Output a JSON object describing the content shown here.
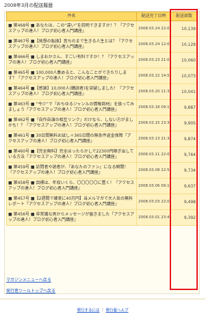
{
  "page_title": "2008年3月の配送履歴",
  "table": {
    "headers": {
      "title": "件名",
      "date": "配送完了日時",
      "count": "配送部数"
    },
    "rows": [
      {
        "title": "■ 第468号 ■ あなたは、この“違い”を説明できますか！？『アクセスアップの達人！ブログ初心者入門講座』",
        "date": "2008.03.24 22:00",
        "count": "10,139"
      },
      {
        "title": "■ 第467号 ■【発想の転換】音ちのまで生きる人生とは？『アクセスアップの達人！ブログ初心者入門講座』",
        "date": "2008.03.24 12:00",
        "count": "10,129"
      },
      {
        "title": "■ 第466号 ■ しまおかさん、すごい有料ですか！？『アクセスアップの達人！ブログ初心者入門講座』",
        "date": "2008.03.23 21:00",
        "count": "10,060"
      },
      {
        "title": "■ 第465号 ■ 100,000人集めると、こんなことができたりします？『アクセスアップの達人！ブログ初心者入門講座』",
        "date": "2008.03.22 14:5",
        "count": "10,073"
      },
      {
        "title": "■ 第464号 ■【感謝】10,000人(購読者)を突破しました！『アクセスアップの達人！ブログ初心者入門講座』",
        "date": "2008.03.20 11:3",
        "count": "10,041"
      },
      {
        "title": "■ 第463号 ■ “今少”で『おちゆるジャンルの情報商材』を扱ってみましょう『アクセスアップの達人！ブログ初心者入門講座』",
        "date": "2008.03.18 09:1",
        "count": "9,887"
      },
      {
        "title": "■ 第462号 ■『自作自演の相互リンク』だけなら、しない方がましかも！？『アクセスアップの達人！ブログ初心者入門講座』",
        "date": "2008.03.15 23:3",
        "count": "9,905"
      },
      {
        "title": "■ 第461号 ■ 30日間無料お試し＋365日間の無条件返金保障『アクセスアップの達人！ブログ初心者入門講座』",
        "date": "2008.03.13 21:3",
        "count": "9,874"
      },
      {
        "title": "■ 第460号 ■【完全無料】完全ほったらかしで22300円稼ぎ出している方法『アクセスアップの達人！ブログ初心者入門講座』",
        "date": "2008.03.11 22:0",
        "count": "9,764"
      },
      {
        "title": "■ 第459号 ■ 訪問者や読者が、『あなたのファン』になる瞬間！『アクセスアップの達人！ブログ初心者入門講座』",
        "date": "2008.03.08 22:5",
        "count": "9,734"
      },
      {
        "title": "■ 第458号 ■ 目標は、年収いくら、〇〇〇〇〇に置く！『アクセスアップの達人！ブログ初心者入門講座』",
        "date": "2008.03.06 09:1",
        "count": "9,637"
      },
      {
        "title": "■ 第457号 ■【2週間で確実に40万円】当メルマガで大人気の無料レポート『アクセスアップの達人！ブログ初心者入門講座』",
        "date": "2008.03.03 22:0",
        "count": "9,498"
      },
      {
        "title": "■ 第456号 ■ 非常識な男からメッセージが届きました『アクセスアップの達人！ブログ初心者入門講座』",
        "date": "2008.03.01 23:4",
        "count": "9,392"
      }
    ]
  },
  "links": {
    "magazine_menu": "マガジンメニューへ戻る",
    "publisher_tools": "発行者ツールトップへ戻る"
  },
  "footer": {
    "how_to_publish": "発行するには",
    "separator": "｜",
    "publisher_help": "発行者ヘルプ"
  },
  "colors": {
    "header_bg": "#ffd966",
    "row_bg": "#fff2c2",
    "highlight": "#e8141c",
    "link": "#1a55cc"
  }
}
